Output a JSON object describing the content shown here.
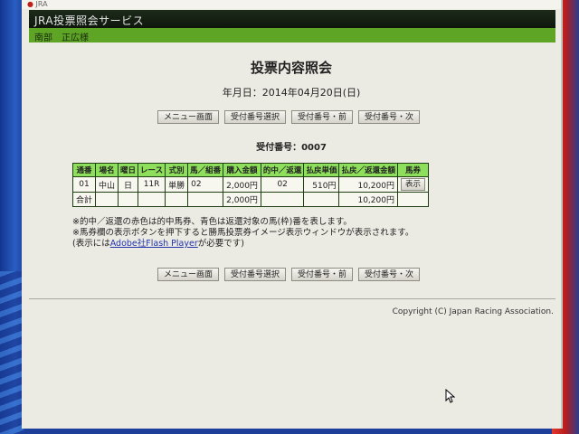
{
  "logo_text": "JRA",
  "header": {
    "title": "JRA投票照会サービス",
    "user": "南部　正広様"
  },
  "page_title": "投票内容照会",
  "date_line": "年月日：2014年04月20日(日)",
  "nav": {
    "menu": "メニュー画面",
    "select": "受付番号選択",
    "prev": "受付番号・前",
    "next": "受付番号・次"
  },
  "receipt_label": "受付番号：0007",
  "table": {
    "headers": [
      "通番",
      "場名",
      "曜日",
      "レース",
      "式別",
      "馬／組番",
      "購入金額",
      "的中／返還",
      "払戻単価",
      "払戻／返還金額",
      "馬券"
    ],
    "row": {
      "seq": "01",
      "venue": "中山",
      "day": "日",
      "race": "11R",
      "type": "単勝",
      "combo": "02",
      "amount": "2,000円",
      "hit": "02",
      "unit": "510円",
      "payout": "10,200円",
      "ticket_btn": "表示"
    },
    "total": {
      "label": "合計",
      "amount": "2,000円",
      "payout": "10,200円"
    }
  },
  "notes": {
    "line1": "※的中／返還の赤色は的中馬券、青色は返還対象の馬(枠)番を表します。",
    "line2": "※馬券欄の表示ボタンを押下すると勝馬投票券イメージ表示ウィンドウが表示されます。",
    "line3_pre": "(表示には",
    "line3_link": "Adobe社Flash Player",
    "line3_post": "が必要です)"
  },
  "copyright": "Copyright (C) Japan Racing Association."
}
